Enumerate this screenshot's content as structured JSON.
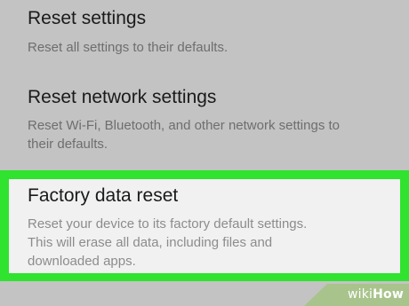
{
  "settings_items": [
    {
      "title": "Reset settings",
      "description": "Reset all settings to their defaults."
    },
    {
      "title": "Reset network settings",
      "description": "Reset Wi-Fi, Bluetooth, and other network settings to their defaults."
    },
    {
      "title": "Factory data reset",
      "description": "Reset your device to its factory default settings. This will erase all data, including files and downloaded apps."
    }
  ],
  "highlight_color": "#2fe32f",
  "watermark": {
    "prefix": "wiki",
    "suffix": "How"
  }
}
